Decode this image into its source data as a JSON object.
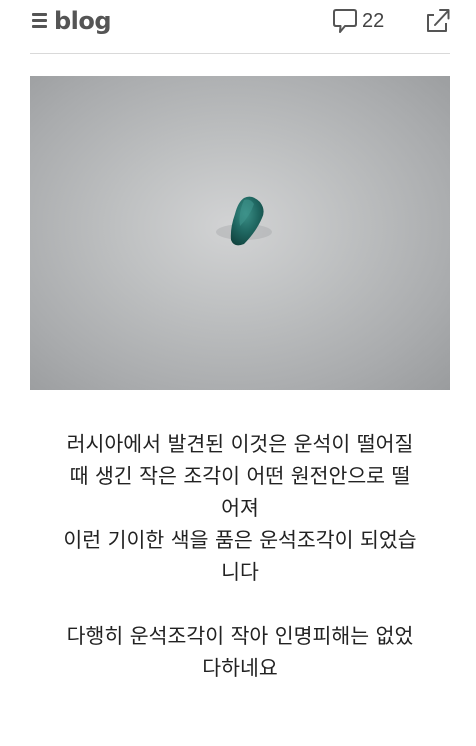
{
  "header": {
    "logo_text": "blog",
    "comment_count": "22",
    "menu_icon": "hamburger-menu-icon",
    "comment_icon": "speech-bubble-icon",
    "share_icon": "share-arrow-icon"
  },
  "photo": {
    "subject": "meteorite-fragment",
    "colors": {
      "background": "#bfc1c2",
      "fragment": "#1f6660"
    }
  },
  "post": {
    "paragraph_1": "러시아에서 발견된 이것은 운석이 떨어질\n때 생긴 작은 조각이 어떤 원전안으로 떨\n어져\n이런 기이한 색을 품은 운석조각이 되었습\n니다",
    "paragraph_2": "다행히 운석조각이 작아 인명피해는 없었\n다하네요"
  },
  "colors": {
    "text": "#222222",
    "icon": "#555555",
    "divider": "#d9d9d9"
  }
}
